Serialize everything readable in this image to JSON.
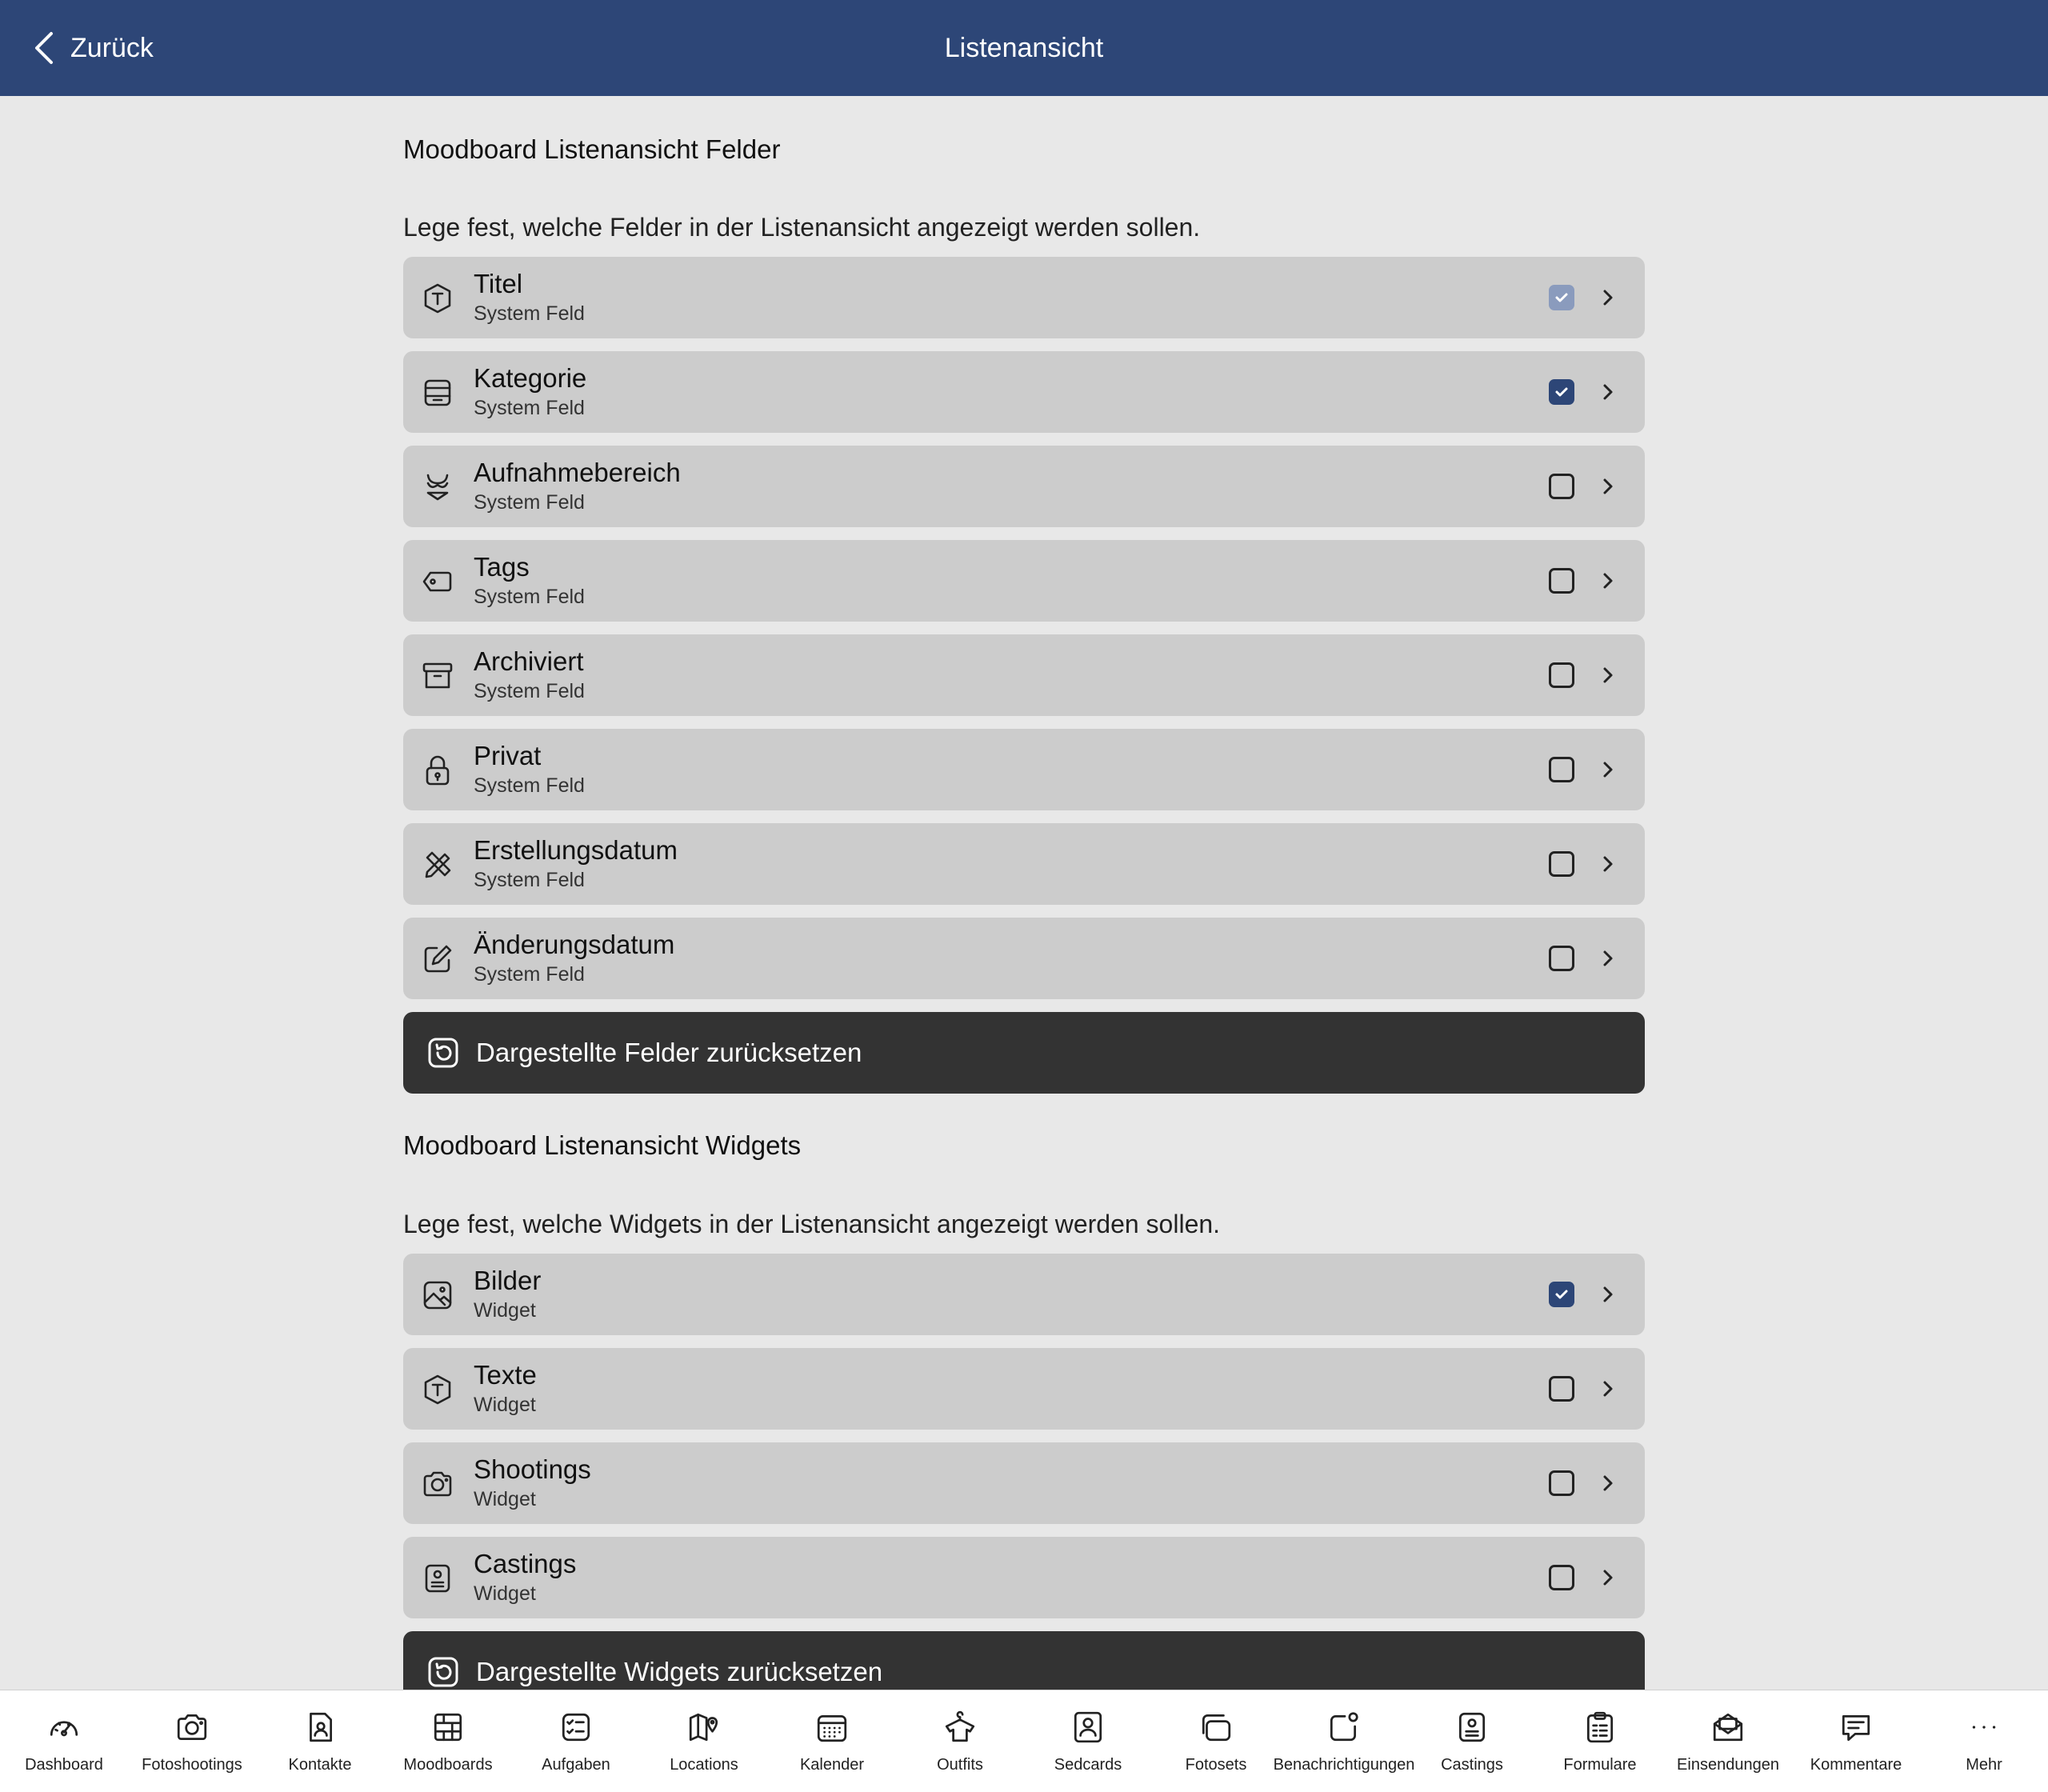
{
  "header": {
    "back_label": "Zurück",
    "title": "Listenansicht"
  },
  "fields_section": {
    "title": "Moodboard Listenansicht Felder",
    "description": "Lege fest, welche Felder in der Listenansicht angezeigt werden sollen.",
    "items": [
      {
        "title": "Titel",
        "subtitle": "System Feld",
        "icon": "text-badge-icon",
        "state": "locked-checked"
      },
      {
        "title": "Kategorie",
        "subtitle": "System Feld",
        "icon": "stack-icon",
        "state": "checked"
      },
      {
        "title": "Aufnahmebereich",
        "subtitle": "System Feld",
        "icon": "bikini-icon",
        "state": "unchecked"
      },
      {
        "title": "Tags",
        "subtitle": "System Feld",
        "icon": "tag-icon",
        "state": "unchecked"
      },
      {
        "title": "Archiviert",
        "subtitle": "System Feld",
        "icon": "archive-icon",
        "state": "unchecked"
      },
      {
        "title": "Privat",
        "subtitle": "System Feld",
        "icon": "lock-icon",
        "state": "unchecked"
      },
      {
        "title": "Erstellungsdatum",
        "subtitle": "System Feld",
        "icon": "pencil-ruler-icon",
        "state": "unchecked"
      },
      {
        "title": "Änderungsdatum",
        "subtitle": "System Feld",
        "icon": "edit-icon",
        "state": "unchecked"
      }
    ],
    "reset_label": "Dargestellte Felder zurücksetzen"
  },
  "widgets_section": {
    "title": "Moodboard Listenansicht Widgets",
    "description": "Lege fest, welche Widgets in der Listenansicht angezeigt werden sollen.",
    "items": [
      {
        "title": "Bilder",
        "subtitle": "Widget",
        "icon": "image-icon",
        "state": "checked"
      },
      {
        "title": "Texte",
        "subtitle": "Widget",
        "icon": "text-badge-icon",
        "state": "unchecked"
      },
      {
        "title": "Shootings",
        "subtitle": "Widget",
        "icon": "camera-icon",
        "state": "unchecked"
      },
      {
        "title": "Castings",
        "subtitle": "Widget",
        "icon": "id-card-icon",
        "state": "unchecked"
      }
    ],
    "reset_label": "Dargestellte Widgets zurücksetzen"
  },
  "tabbar": [
    {
      "label": "Dashboard",
      "icon": "gauge-icon"
    },
    {
      "label": "Fotoshootings",
      "icon": "camera-icon"
    },
    {
      "label": "Kontakte",
      "icon": "contact-file-icon"
    },
    {
      "label": "Moodboards",
      "icon": "grid-board-icon"
    },
    {
      "label": "Aufgaben",
      "icon": "checklist-icon"
    },
    {
      "label": "Locations",
      "icon": "map-pin-icon"
    },
    {
      "label": "Kalender",
      "icon": "calendar-icon"
    },
    {
      "label": "Outfits",
      "icon": "hanger-shirt-icon"
    },
    {
      "label": "Sedcards",
      "icon": "portrait-card-icon"
    },
    {
      "label": "Fotosets",
      "icon": "photo-stack-icon"
    },
    {
      "label": "Benachrichtigungen",
      "icon": "notification-icon"
    },
    {
      "label": "Castings",
      "icon": "id-card-icon"
    },
    {
      "label": "Formulare",
      "icon": "clipboard-icon"
    },
    {
      "label": "Einsendungen",
      "icon": "mail-open-icon"
    },
    {
      "label": "Kommentare",
      "icon": "comment-icon"
    },
    {
      "label": "Mehr",
      "icon": "more-dots-icon"
    }
  ]
}
